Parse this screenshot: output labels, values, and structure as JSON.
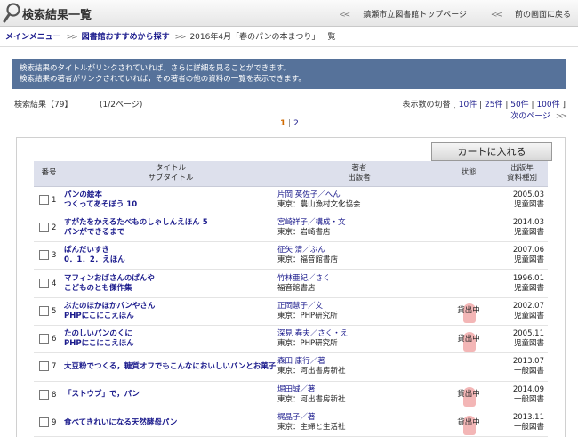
{
  "header": {
    "title": "検索結果一覧",
    "link_top": "鎮瀬市立図書館トップページ",
    "link_back": "前の画面に戻る"
  },
  "breadcrumb": {
    "item1": "メインメニュー",
    "item2": "図書館おすすめから探す",
    "item3": "2016年4月「春のパンの本まつり」一覧"
  },
  "info": {
    "line1": "検索結果のタイトルがリンクされていれば，さらに詳細を見ることができます。",
    "line2": "検索結果の著者がリンクされていれば，その著者の他の資料の一覧を表示できます。"
  },
  "results": {
    "count_label": "検索結果【79】",
    "page_label": "(1/2ページ)",
    "display_label": "表示数の切替",
    "display_options": [
      "10件",
      "25件",
      "50件",
      "100件"
    ],
    "next_page": "次のページ",
    "pages": [
      "1",
      "2"
    ]
  },
  "cart_button": "カートに入れる",
  "table": {
    "headers": {
      "num": "番号",
      "title": "タイトル",
      "subtitle": "サブタイトル",
      "author": "著者",
      "publisher": "出版者",
      "status": "状態",
      "year": "出版年",
      "type": "資料種別"
    },
    "rows": [
      {
        "num": "1",
        "title": "パンの絵本",
        "subtitle": "つくってあそぼう 10",
        "author": "片岡 英佐子／へん",
        "publisher": "東京：農山漁村文化協会",
        "status": "",
        "year": "2005.03",
        "type": "児童図書"
      },
      {
        "num": "2",
        "title": "すがたをかえるたべものしゃしんえほん 5",
        "subtitle": "パンができるまで",
        "author": "宮崎祥子／構成・文",
        "publisher": "東京：岩崎書店",
        "status": "",
        "year": "2014.03",
        "type": "児童図書"
      },
      {
        "num": "3",
        "title": "ぱんだいすき",
        "subtitle": "0．1．2．えほん",
        "author": "征矢 清／ぶん",
        "publisher": "東京：福音館書店",
        "status": "",
        "year": "2007.06",
        "type": "児童図書"
      },
      {
        "num": "4",
        "title": "マフィンおばさんのぱんや",
        "subtitle": "こどものとも傑作集",
        "author": "竹林亜紀／さく",
        "publisher": "福音館書店",
        "status": "",
        "year": "1996.01",
        "type": "児童図書"
      },
      {
        "num": "5",
        "title": "ぶたのほかほかパンやさん",
        "subtitle": "PHPにこにこえほん",
        "author": "正岡慧子／文",
        "publisher": "東京：PHP研究所",
        "status": "貸出中",
        "year": "2002.07",
        "type": "児童図書"
      },
      {
        "num": "6",
        "title": "たのしいパンのくに",
        "subtitle": "PHPにこにこえほん",
        "author": "深見 春夫／さく・え",
        "publisher": "東京：PHP研究所",
        "status": "貸出中",
        "year": "2005.11",
        "type": "児童図書"
      },
      {
        "num": "7",
        "title": "大豆粉でつくる，糖質オフでもこんなにおいしいパンとお菓子",
        "subtitle": "",
        "author": "森田 康行／著",
        "publisher": "東京：河出書房新社",
        "status": "",
        "year": "2013.07",
        "type": "一般図書"
      },
      {
        "num": "8",
        "title": "「ストウブ」で，パン",
        "subtitle": "",
        "author": "堀田誠／著",
        "publisher": "東京：河出書房新社",
        "status": "貸出中",
        "year": "2014.09",
        "type": "一般図書"
      },
      {
        "num": "9",
        "title": "食べてきれいになる天然酵母パン",
        "subtitle": "",
        "author": "梶晶子／著",
        "publisher": "東京：主婦と生活社",
        "status": "貸出中",
        "year": "2013.11",
        "type": "一般図書"
      }
    ]
  }
}
